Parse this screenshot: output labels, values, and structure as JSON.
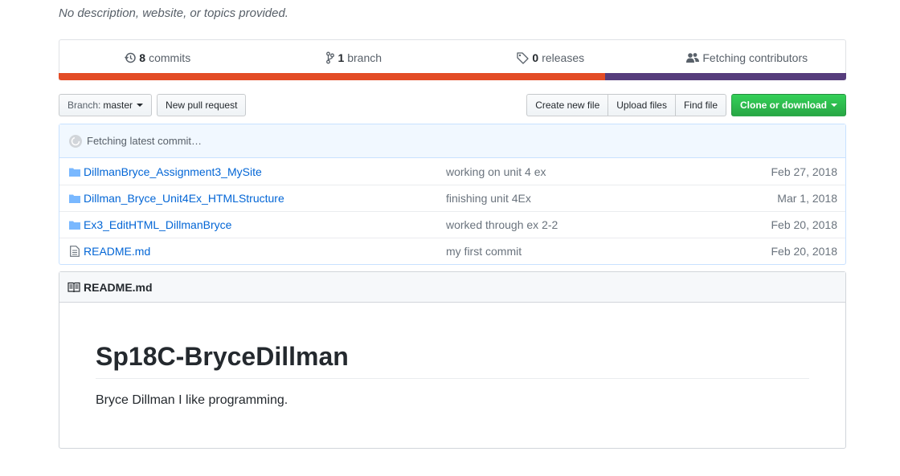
{
  "repo": {
    "description": "No description, website, or topics provided."
  },
  "stats": {
    "commits": {
      "count": "8",
      "label": "commits",
      "icon": "history-icon"
    },
    "branches": {
      "count": "1",
      "label": "branch",
      "icon": "branch-icon"
    },
    "releases": {
      "count": "0",
      "label": "releases",
      "icon": "tag-icon"
    },
    "contributors": {
      "label": "Fetching contributors",
      "icon": "people-icon"
    }
  },
  "language_bar": [
    {
      "color": "#e34c26",
      "fraction": 0.694
    },
    {
      "color": "#563d7c",
      "fraction": 0.306
    }
  ],
  "toolbar": {
    "branch_prefix": "Branch:",
    "branch_name": "master",
    "new_pull_request": "New pull request",
    "create_new_file": "Create new file",
    "upload_files": "Upload files",
    "find_file": "Find file",
    "clone_or_download": "Clone or download"
  },
  "commit_tease": {
    "text": "Fetching latest commit…"
  },
  "files": [
    {
      "type": "dir",
      "name": "DillmanBryce_Assignment3_MySite",
      "message": "working on unit 4 ex",
      "age": "Feb 27, 2018"
    },
    {
      "type": "dir",
      "name": "Dillman_Bryce_Unit4Ex_HTMLStructure",
      "message": "finishing unit 4Ex",
      "age": "Mar 1, 2018"
    },
    {
      "type": "dir",
      "name": "Ex3_EditHTML_DillmanBryce",
      "message": "worked through ex 2-2",
      "age": "Feb 20, 2018"
    },
    {
      "type": "file",
      "name": "README.md",
      "message": "my first commit",
      "age": "Feb 20, 2018"
    }
  ],
  "readme": {
    "filename": "README.md",
    "heading": "Sp18C-BryceDillman",
    "body": "Bryce Dillman I like programming."
  },
  "colors": {
    "link": "#0366d6",
    "primary_button": "#28a745",
    "folder_icon": "#79b8ff"
  }
}
